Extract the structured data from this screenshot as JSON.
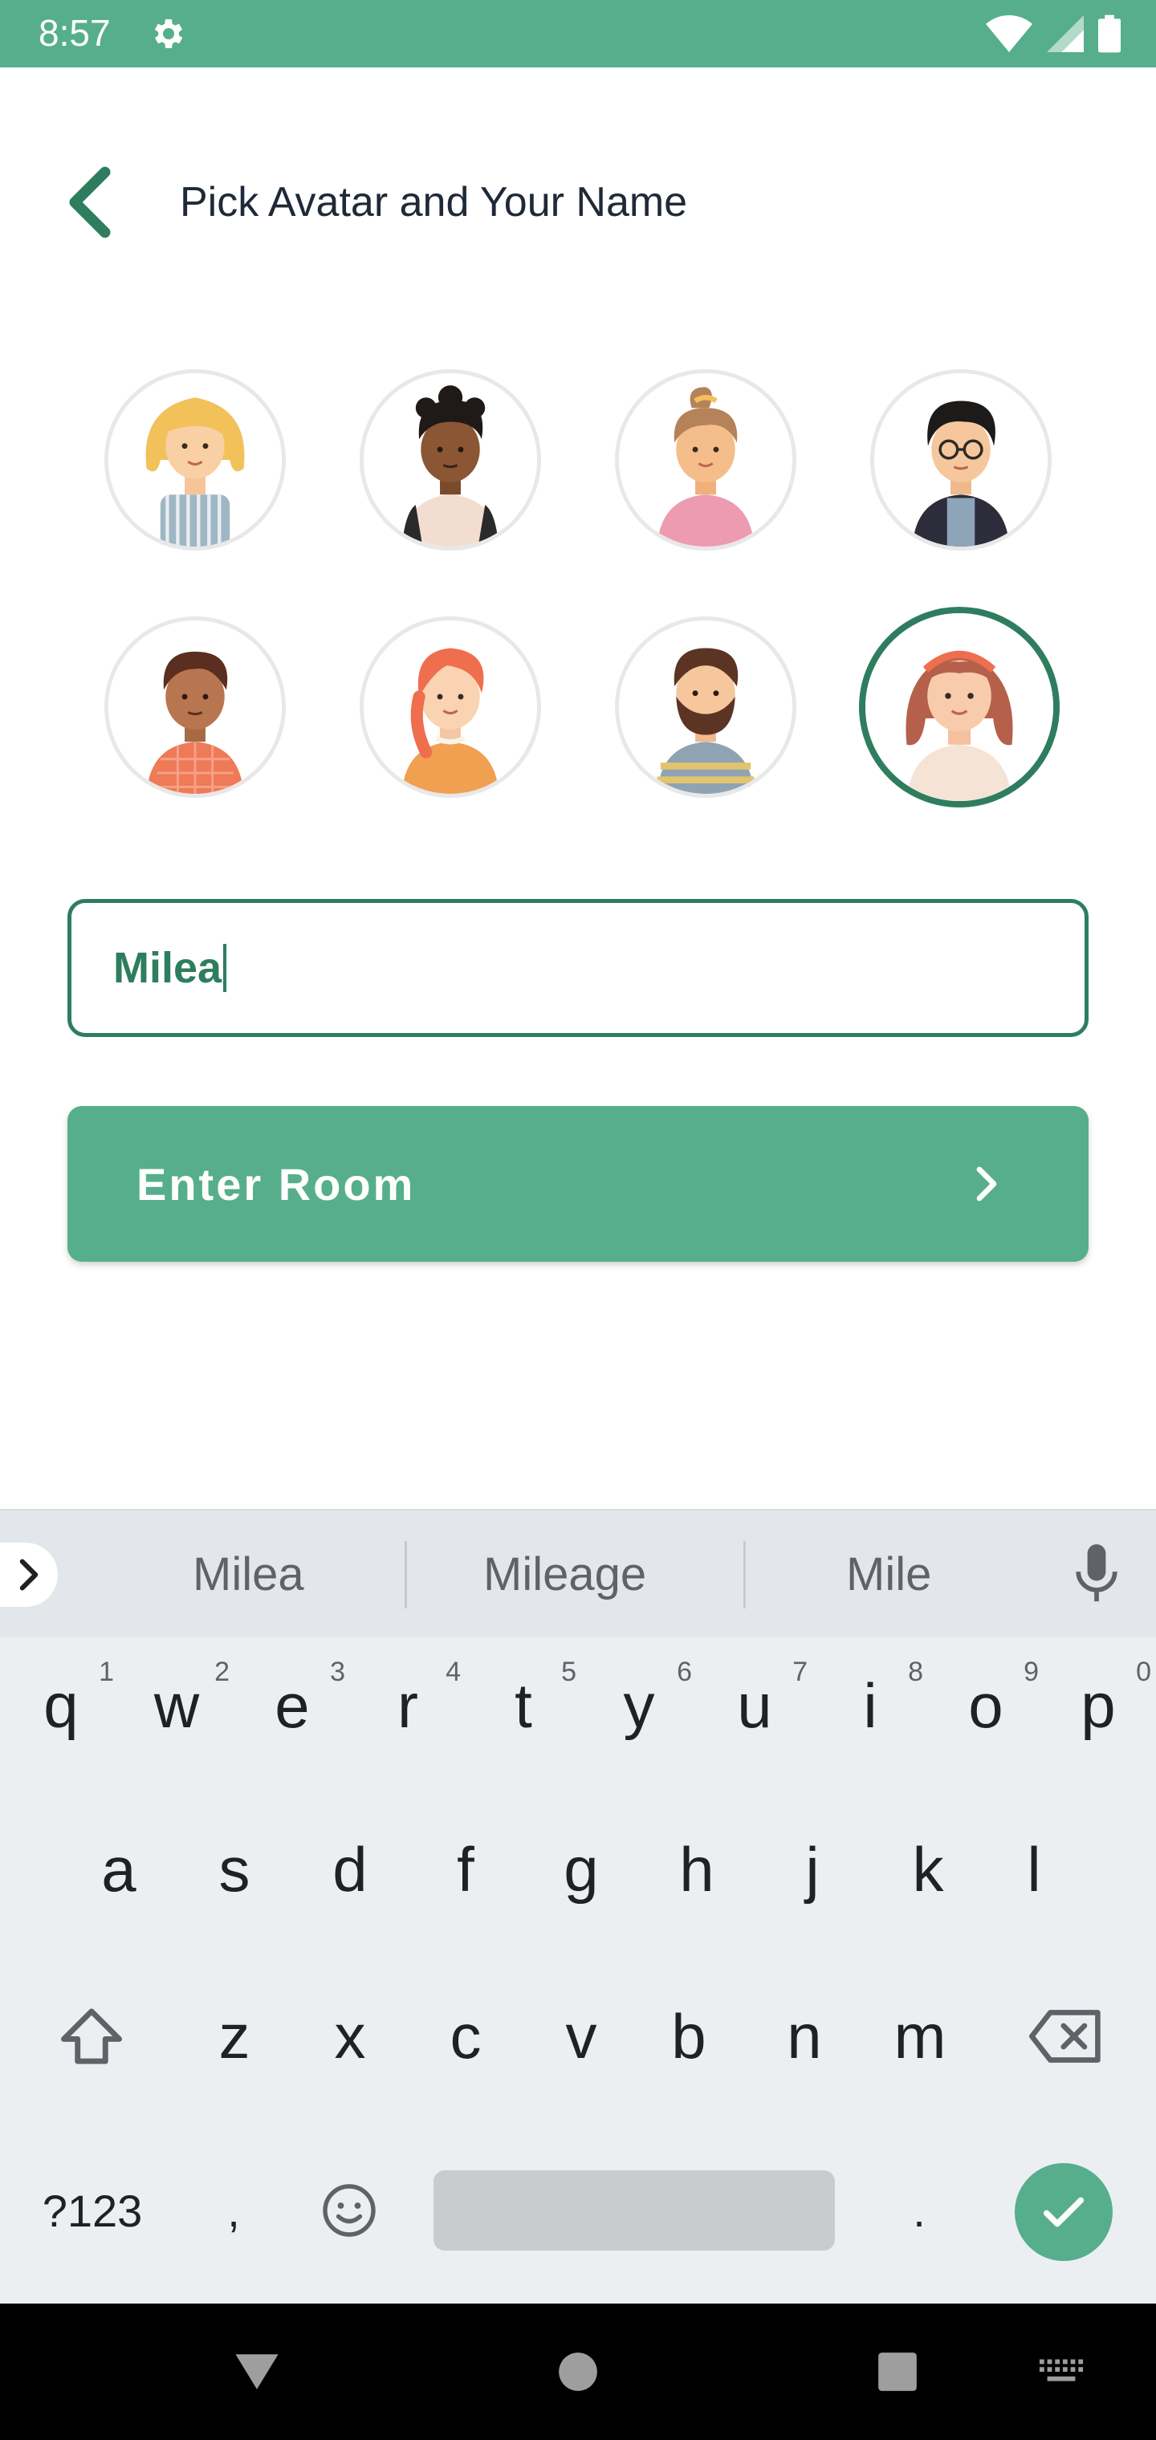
{
  "status_bar": {
    "time": "8:57",
    "icons": [
      "gear-icon",
      "wifi-icon",
      "signal-icon",
      "battery-icon"
    ]
  },
  "header": {
    "back_icon": "chevron-left-icon",
    "title": "Pick Avatar and Your Name"
  },
  "avatars": {
    "selected_index": 7,
    "items": [
      {
        "name": "blonde-girl-avatar"
      },
      {
        "name": "curly-boy-avatar"
      },
      {
        "name": "ponytail-girl-avatar"
      },
      {
        "name": "glasses-boy-avatar"
      },
      {
        "name": "brown-boy-avatar"
      },
      {
        "name": "redhead-braid-girl-avatar"
      },
      {
        "name": "bearded-man-avatar"
      },
      {
        "name": "headband-girl-avatar"
      }
    ]
  },
  "form": {
    "name_value": "Milea",
    "enter_button_label": "Enter Room"
  },
  "keyboard": {
    "suggestions": [
      "Milea",
      "Mileage",
      "Mile"
    ],
    "row1": [
      {
        "key": "q",
        "hint": "1"
      },
      {
        "key": "w",
        "hint": "2"
      },
      {
        "key": "e",
        "hint": "3"
      },
      {
        "key": "r",
        "hint": "4"
      },
      {
        "key": "t",
        "hint": "5"
      },
      {
        "key": "y",
        "hint": "6"
      },
      {
        "key": "u",
        "hint": "7"
      },
      {
        "key": "i",
        "hint": "8"
      },
      {
        "key": "o",
        "hint": "9"
      },
      {
        "key": "p",
        "hint": "0"
      }
    ],
    "row2": [
      "a",
      "s",
      "d",
      "f",
      "g",
      "h",
      "j",
      "k",
      "l"
    ],
    "row3": [
      "z",
      "x",
      "c",
      "v",
      "b",
      "n",
      "m"
    ],
    "symbols_label": "?123",
    "comma_label": ",",
    "period_label": "."
  },
  "colors": {
    "accent": "#56ae8d",
    "accent_dark": "#2e7d5f"
  }
}
